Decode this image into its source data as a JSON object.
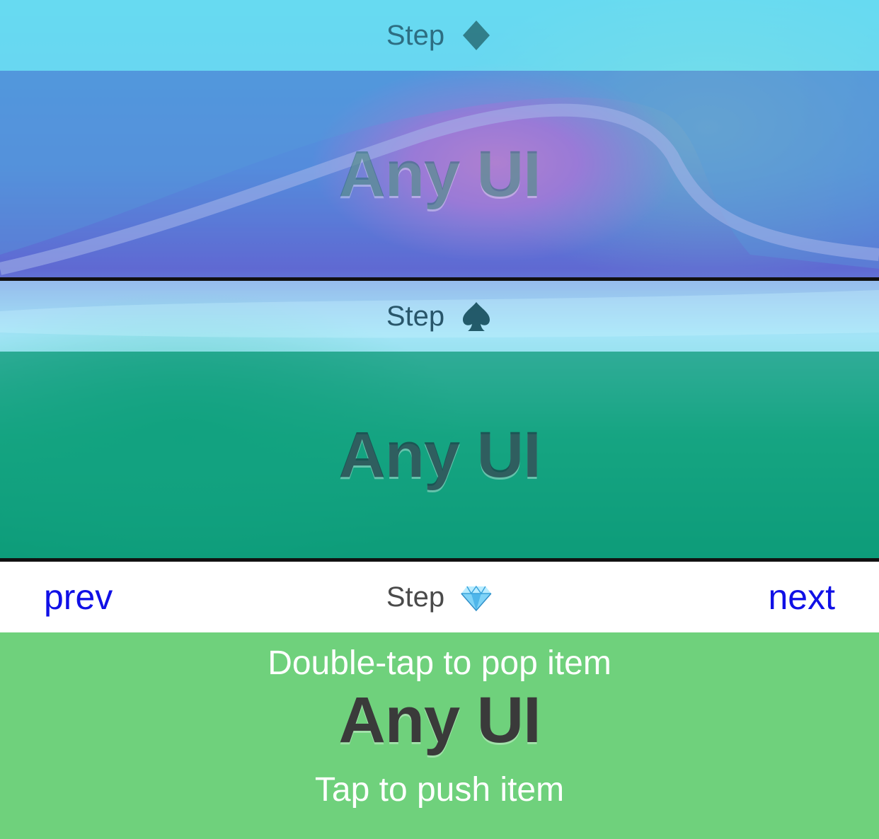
{
  "colors": {
    "link": "#1010e6",
    "bottom_card_bg": "#6fd17c",
    "navbar_bg": "#ffffff"
  },
  "cards": [
    {
      "nav_title": "Step",
      "nav_icon": "diamond-suit-icon",
      "content": "Any UI"
    },
    {
      "nav_title": "Step",
      "nav_icon": "spade-suit-icon",
      "content": "Any UI"
    },
    {
      "nav_title": "Step",
      "nav_icon": "gem-icon",
      "prev_label": "prev",
      "next_label": "next",
      "hint_top": "Double-tap to pop item",
      "content": "Any UI",
      "hint_bottom": "Tap to push item"
    }
  ]
}
